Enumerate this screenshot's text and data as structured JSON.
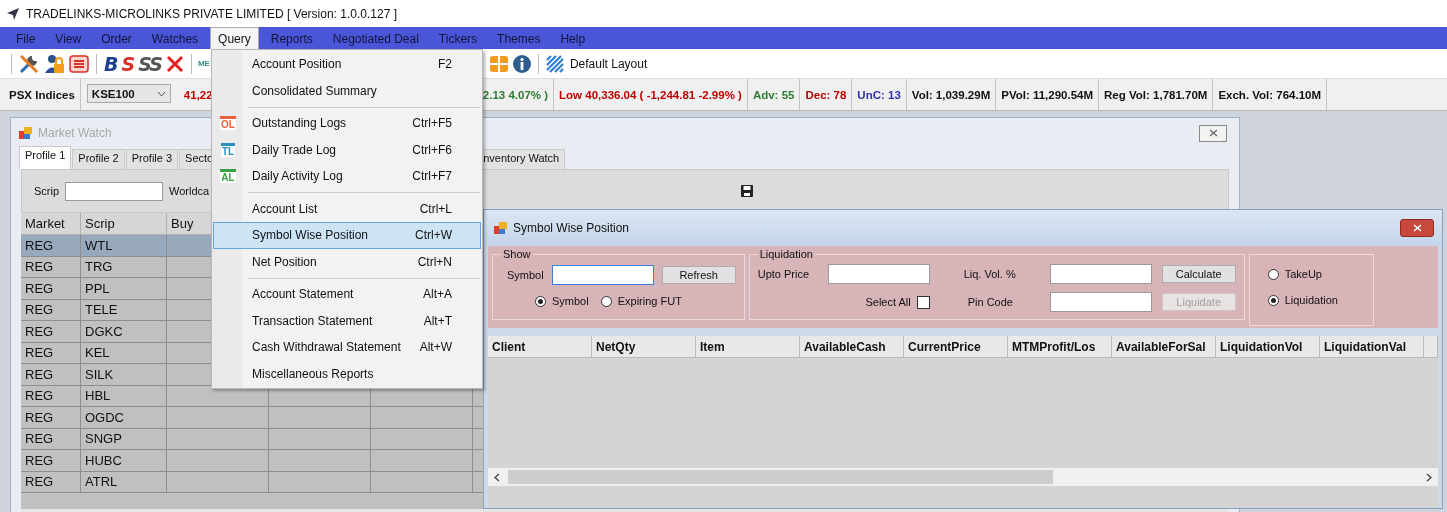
{
  "window": {
    "title": "TRADELINKS-MICROLINKS PRIVATE LIMITED [ Version: 1.0.0.127 ]"
  },
  "menu_bar": [
    {
      "label": "File",
      "selected": false
    },
    {
      "label": "View",
      "selected": false
    },
    {
      "label": "Order",
      "selected": false
    },
    {
      "label": "Watches",
      "selected": false
    },
    {
      "label": "Query",
      "selected": true
    },
    {
      "label": "Reports",
      "selected": false
    },
    {
      "label": "Negotiated Deal",
      "selected": false
    },
    {
      "label": "Tickers",
      "selected": false
    },
    {
      "label": "Themes",
      "selected": false
    },
    {
      "label": "Help",
      "selected": false
    }
  ],
  "toolbar": {
    "letter_buttons": [
      {
        "label": "B",
        "color": "#1f3f8f"
      },
      {
        "label": "S",
        "color": "#d9302a"
      },
      {
        "label": "SS",
        "color": "#555555"
      }
    ],
    "cut_label": "ME",
    "layout_button": "Default Layout"
  },
  "index_bar": {
    "label": "PSX Indices",
    "index": "KSE100",
    "values": [
      {
        "text": "41,22",
        "color": "#c00000"
      },
      {
        "text": "2.13 4.07% )",
        "color": "#2e7d32"
      },
      {
        "text": "Low 40,336.04 ( -1,244.81 -2.99% )",
        "color": "#c00000"
      },
      {
        "text": "Adv: 55",
        "color": "#2e7d32"
      },
      {
        "text": "Dec: 78",
        "color": "#c00000"
      },
      {
        "text": "UnC: 13",
        "color": "#2f2fb0"
      },
      {
        "text": "Vol: 1,039.29M",
        "color": "#111111"
      },
      {
        "text": "PVol: 11,290.54M",
        "color": "#111111"
      },
      {
        "text": "Reg Vol: 1,781.70M",
        "color": "#111111"
      },
      {
        "text": "Exch. Vol: 764.10M",
        "color": "#111111"
      }
    ]
  },
  "query_menu": [
    {
      "kind": "item",
      "label": "Account Position",
      "shortcut": "F2",
      "highlighted": false
    },
    {
      "kind": "item",
      "label": "Consolidated Summary",
      "highlighted": false
    },
    {
      "kind": "separator"
    },
    {
      "kind": "item",
      "label": "Outstanding Logs",
      "shortcut": "Ctrl+F5",
      "badge": "OL",
      "color": "#e8603c",
      "highlighted": false
    },
    {
      "kind": "item",
      "label": "Daily Trade Log",
      "shortcut": "Ctrl+F6",
      "badge": "TL",
      "color": "#2a8fc0",
      "highlighted": false
    },
    {
      "kind": "item",
      "label": "Daily Activity Log",
      "shortcut": "Ctrl+F7",
      "badge": "AL",
      "color": "#3aa040",
      "highlighted": false
    },
    {
      "kind": "separator"
    },
    {
      "kind": "item",
      "label": "Account List",
      "shortcut": "Ctrl+L",
      "highlighted": false
    },
    {
      "kind": "item",
      "label": "Symbol Wise Position",
      "shortcut": "Ctrl+W",
      "highlighted": true
    },
    {
      "kind": "item",
      "label": "Net Position",
      "shortcut": "Ctrl+N",
      "highlighted": false
    },
    {
      "kind": "separator"
    },
    {
      "kind": "item",
      "label": "Account Statement",
      "shortcut": "Alt+A",
      "highlighted": false
    },
    {
      "kind": "item",
      "label": "Transaction Statement",
      "shortcut": "Alt+T",
      "highlighted": false
    },
    {
      "kind": "item",
      "label": "Cash Withdrawal Statement",
      "shortcut": "Alt+W",
      "highlighted": false
    },
    {
      "kind": "item",
      "label": "Miscellaneous Reports",
      "highlighted": false
    }
  ],
  "market_watch": {
    "title": "Market Watch",
    "active": false,
    "tabs": [
      {
        "label": "Profile 1",
        "selected": true
      },
      {
        "label": "Profile 2",
        "selected": false
      },
      {
        "label": "Profile 3",
        "selected": false
      },
      {
        "label": "Secto",
        "selected": false
      },
      {
        "label": "nventory Watch",
        "selected": false
      }
    ],
    "scrip_label": "Scrip",
    "cut_label": "Worldca",
    "columns": [
      "Market",
      "Scrip",
      "Buy"
    ],
    "rows": [
      {
        "market": "REG",
        "scrip": "WTL",
        "selected": true
      },
      {
        "market": "REG",
        "scrip": "TRG",
        "selected": false
      },
      {
        "market": "REG",
        "scrip": "PPL",
        "selected": false
      },
      {
        "market": "REG",
        "scrip": "TELE",
        "selected": false
      },
      {
        "market": "REG",
        "scrip": "DGKC",
        "selected": false
      },
      {
        "market": "REG",
        "scrip": "KEL",
        "selected": false
      },
      {
        "market": "REG",
        "scrip": "SILK",
        "selected": false
      },
      {
        "market": "REG",
        "scrip": "HBL",
        "selected": false
      },
      {
        "market": "REG",
        "scrip": "OGDC",
        "selected": false
      },
      {
        "market": "REG",
        "scrip": "SNGP",
        "selected": false
      },
      {
        "market": "REG",
        "scrip": "HUBC",
        "selected": false
      },
      {
        "market": "REG",
        "scrip": "ATRL",
        "selected": false
      }
    ]
  },
  "symbol_wise_position": {
    "title": "Symbol Wise Position",
    "show": {
      "legend": "Show",
      "symbol_label": "Symbol",
      "refresh": "Refresh",
      "radios": [
        {
          "label": "Symbol",
          "selected": true
        },
        {
          "label": "Expiring FUT",
          "selected": false
        }
      ]
    },
    "liquidation": {
      "legend": "Liquidation",
      "upto_price": "Upto Price",
      "liq_vol": "Liq. Vol. %",
      "pin_code": "Pin Code",
      "select_all": {
        "label": "Select All",
        "checked": false
      },
      "calculate": {
        "label": "Calculate",
        "disabled": false
      },
      "liquidate": {
        "label": "Liquidate",
        "disabled": true
      }
    },
    "mode": [
      {
        "label": "TakeUp",
        "selected": false
      },
      {
        "label": "Liquidation",
        "selected": true
      }
    ],
    "columns": [
      "Client",
      "NetQty",
      "Item",
      "AvailableCash",
      "CurrentPrice",
      "MTMProfit/Los",
      "AvailableForSal",
      "LiquidationVol",
      "LiquidationVal"
    ]
  }
}
